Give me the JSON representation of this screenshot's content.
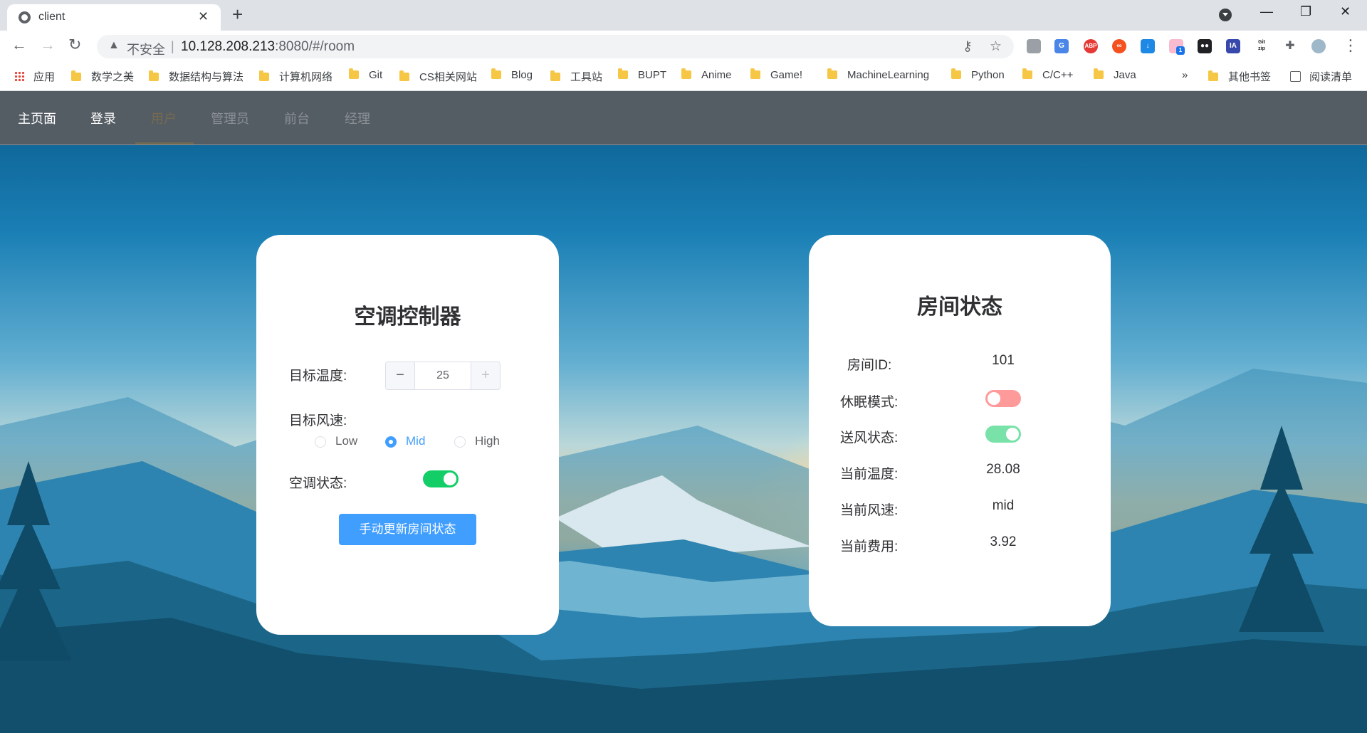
{
  "browser": {
    "tab_title": "client",
    "new_tab_glyph": "+",
    "insecure_label": "不安全",
    "url_host": "10.128.208.213",
    "url_rest": ":8080/#/room",
    "bookmarks": [
      {
        "label": "应用",
        "icon": "apps-grid-icon"
      },
      {
        "label": "数学之美",
        "icon": "folder-icon"
      },
      {
        "label": "数据结构与算法",
        "icon": "folder-icon"
      },
      {
        "label": "计算机网络",
        "icon": "folder-icon"
      },
      {
        "label": "Git",
        "icon": "folder-icon"
      },
      {
        "label": "CS相关网站",
        "icon": "folder-icon"
      },
      {
        "label": "Blog",
        "icon": "folder-icon"
      },
      {
        "label": "工具站",
        "icon": "folder-icon"
      },
      {
        "label": "BUPT",
        "icon": "folder-icon"
      },
      {
        "label": "Anime",
        "icon": "folder-icon"
      },
      {
        "label": "Game!",
        "icon": "folder-icon"
      },
      {
        "label": "MachineLearning",
        "icon": "folder-icon"
      },
      {
        "label": "Python",
        "icon": "folder-icon"
      },
      {
        "label": "C/C++",
        "icon": "folder-icon"
      },
      {
        "label": "Java",
        "icon": "folder-icon"
      }
    ],
    "bookmarks_overflow": "»",
    "other_bookmarks": "其他书签",
    "reading_list": "阅读清单",
    "extension_badges": [
      "ABP",
      "IA",
      "Git zip"
    ],
    "notification_count": "1"
  },
  "appnav": {
    "items": [
      {
        "label": "主页面",
        "state": "normal"
      },
      {
        "label": "登录",
        "state": "normal"
      },
      {
        "label": "用户",
        "state": "active"
      },
      {
        "label": "管理员",
        "state": "disabled"
      },
      {
        "label": "前台",
        "state": "disabled"
      },
      {
        "label": "经理",
        "state": "disabled"
      }
    ]
  },
  "controller": {
    "title": "空调控制器",
    "target_temp_label": "目标温度:",
    "target_temp_value": "25",
    "minus_glyph": "−",
    "plus_glyph": "+",
    "fan_speed_label": "目标风速:",
    "fan_options": [
      {
        "label": "Low",
        "checked": false
      },
      {
        "label": "Mid",
        "checked": true
      },
      {
        "label": "High",
        "checked": false
      }
    ],
    "ac_status_label": "空调状态:",
    "ac_status_on": true,
    "update_button": "手动更新房间状态"
  },
  "room": {
    "title": "房间状态",
    "room_id_label": "房间ID:",
    "room_id": "101",
    "sleep_mode_label": "休眠模式:",
    "sleep_mode_on": false,
    "air_supply_label": "送风状态:",
    "air_supply_on": true,
    "current_temp_label": "当前温度:",
    "current_temp": "28.08",
    "current_speed_label": "当前风速:",
    "current_speed": "mid",
    "current_fee_label": "当前费用:",
    "current_fee": "3.92"
  },
  "colors": {
    "nav_bg": "#545c64",
    "primary": "#409eff",
    "switch_on": "#13ce66",
    "switch_off_disabled": "#ff9a9a",
    "switch_on_disabled": "#78e2a8"
  }
}
